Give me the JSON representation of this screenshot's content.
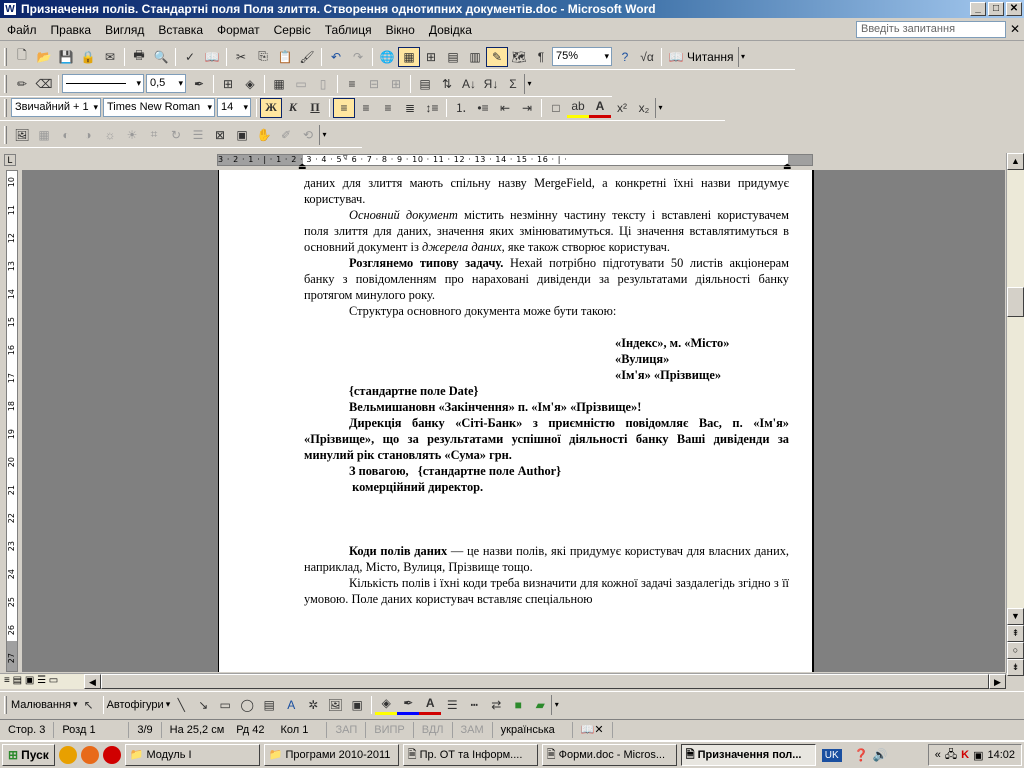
{
  "window": {
    "title": "Призначення полів. Стандартні поля Поля злиття. Створення однотипних документів.doc - Microsoft Word",
    "min": "_",
    "max": "□",
    "close": "✕"
  },
  "menu": {
    "items": [
      "Файл",
      "Правка",
      "Вигляд",
      "Вставка",
      "Формат",
      "Сервіс",
      "Таблиця",
      "Вікно",
      "Довідка"
    ],
    "ask_placeholder": "Введіть запитання",
    "close": "✕"
  },
  "toolbar_standard": {
    "zoom": "75%",
    "reading_label": "Читання"
  },
  "toolbar_tables": {
    "line_weight": "0,5"
  },
  "toolbar_format": {
    "style": "Звичайний + 1",
    "font": "Times New Roman",
    "size": "14",
    "bold": "Ж",
    "italic": "К",
    "underline": "П"
  },
  "ruler": {
    "h_numbers": "3 · 2 · 1 · | · 1 · 2 · 3 · 4 · 5 · 6 · 7 · 8 · 9 · 10 · 11 · 12 · 13 · 14 · 15 · 16 · | ·",
    "v_numbers": [
      "10",
      "11",
      "12",
      "13",
      "14",
      "15",
      "16",
      "17",
      "18",
      "19",
      "20",
      "21",
      "22",
      "23",
      "24",
      "25",
      "26",
      "27"
    ]
  },
  "document": {
    "p1": "даних для злиття мають спільну назву MergeField, а конкретні їхні назви придумує користувач.",
    "p2a": "Основний документ",
    "p2b": " містить незмінну частину тексту і вставлені користувачем поля злиття для даних, значення яких змінюватимуться. Ці значення вставлятимуться в основний документ із ",
    "p2c": "джерела даних,",
    "p2d": " яке також створює користувач.",
    "p3a": "Розглянемо типову задачу.",
    "p3b": " Нехай потрібно підготувати 50 листів акціонерам банку з повідомленням про нараховані дивіденди за результатами діяльності банку протягом минулого року.",
    "p4": "Структура основного документа може бути такою:",
    "addr1": "«Індекс», м. «Місто»",
    "addr2": "«Вулиця»",
    "addr3": "«Ім'я» «Прізвище»",
    "l1": "{стандартне поле Date}",
    "l2": "Вельмишановн «Закінчення» п. «Ім'я» «Прізвище»!",
    "l3": "Дирекція банку «Сіті-Банк» з приємністю повідомляє Вас, п. «Ім'я» «Прізвище», що за результатами успішної діяльності банку Ваші дивіденди за минулий рік становлять «Сума» грн.",
    "l4": "З повагою,   {стандартне поле Author}",
    "l5": " комерційний директор.",
    "p5a": "Коди полів даних",
    "p5b": " — це назви полів, які придумує користувач для власних даних, наприклад, Місто, Вулиця, Прізвище тощо.",
    "p6": "Кількість полів і їхні коди треба визначити для кожної задачі заздалегідь згідно з її умовою. Поле даних користувач вставляє спеціальною"
  },
  "drawing": {
    "draw_label": "Малювання",
    "autoshapes_label": "Автофігури"
  },
  "status": {
    "page": "Стор.  3",
    "section": "Розд  1",
    "pages": "3/9",
    "pos": "На 25,2 см",
    "line": "Рд  42",
    "col": "Кол  1",
    "rec": "ЗАП",
    "trk": "ВИПР",
    "ext": "ВДЛ",
    "ovr": "ЗАМ",
    "lang": "українська"
  },
  "taskbar": {
    "start": "Пуск",
    "buttons": [
      "Модуль І",
      "Програми 2010-2011",
      "Пр. ОТ та Інформ....",
      "Форми.doc - Micros...",
      "Призначення пол..."
    ],
    "lang": "UK",
    "clock": "14:02"
  }
}
